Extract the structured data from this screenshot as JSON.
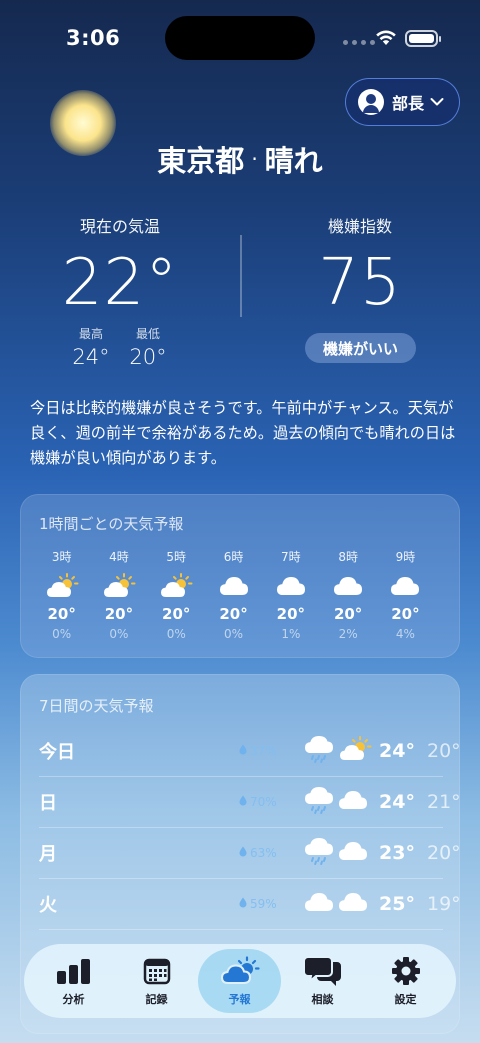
{
  "status_bar": {
    "time": "3:06"
  },
  "profile": {
    "label": "部長"
  },
  "location": {
    "city": "東京都",
    "separator": "·",
    "condition": "晴れ"
  },
  "current": {
    "temp_label": "現在の気温",
    "temp": "22°",
    "high_label": "最高",
    "high": "24°",
    "low_label": "最低",
    "low": "20°"
  },
  "mood": {
    "label": "機嫌指数",
    "value": "75",
    "badge": "機嫌がいい"
  },
  "summary": "今日は比較的機嫌が良さそうです。午前中がチャンス。天気が良く、週の前半で余裕があるため。過去の傾向でも晴れの日は機嫌が良い傾向があります。",
  "hourly": {
    "title": "1時間ごとの天気予報",
    "items": [
      {
        "time": "3時",
        "icon": "partly-sunny-icon",
        "temp": "20°",
        "prob": "0%"
      },
      {
        "time": "4時",
        "icon": "partly-sunny-icon",
        "temp": "20°",
        "prob": "0%"
      },
      {
        "time": "5時",
        "icon": "partly-sunny-icon",
        "temp": "20°",
        "prob": "0%"
      },
      {
        "time": "6時",
        "icon": "cloud-icon",
        "temp": "20°",
        "prob": "0%"
      },
      {
        "time": "7時",
        "icon": "cloud-icon",
        "temp": "20°",
        "prob": "1%"
      },
      {
        "time": "8時",
        "icon": "cloud-icon",
        "temp": "20°",
        "prob": "2%"
      },
      {
        "time": "9時",
        "icon": "cloud-icon",
        "temp": "20°",
        "prob": "4%"
      }
    ]
  },
  "weekly": {
    "title": "7日間の天気予報",
    "days": [
      {
        "day": "今日",
        "prob": "37%",
        "icons": [
          "rain-cloud-icon",
          "partly-sunny-icon"
        ],
        "high": "24°",
        "low": "20°"
      },
      {
        "day": "日",
        "prob": "70%",
        "icons": [
          "rain-cloud-icon",
          "cloud-icon"
        ],
        "high": "24°",
        "low": "21°"
      },
      {
        "day": "月",
        "prob": "63%",
        "icons": [
          "rain-cloud-icon",
          "cloud-icon"
        ],
        "high": "23°",
        "low": "20°"
      },
      {
        "day": "火",
        "prob": "59%",
        "icons": [
          "cloud-icon",
          "cloud-icon"
        ],
        "high": "25°",
        "low": "19°"
      }
    ]
  },
  "tabs": [
    {
      "label": "分析",
      "icon": "bar-chart-icon",
      "active": false
    },
    {
      "label": "記録",
      "icon": "calendar-icon",
      "active": false
    },
    {
      "label": "予報",
      "icon": "partly-sunny-icon",
      "active": true
    },
    {
      "label": "相談",
      "icon": "chat-bubbles-icon",
      "active": false
    },
    {
      "label": "設定",
      "icon": "gear-icon",
      "active": false
    }
  ],
  "colors": {
    "accent": "#2577d4",
    "sun": "#f5c23a",
    "rain": "#6fb2ee"
  }
}
